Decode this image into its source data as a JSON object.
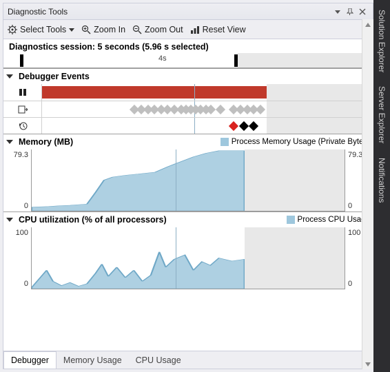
{
  "window": {
    "title": "Diagnostic Tools"
  },
  "toolbar": {
    "select_tools": "Select Tools",
    "zoom_in": "Zoom In",
    "zoom_out": "Zoom Out",
    "reset_view": "Reset View"
  },
  "session": {
    "label": "Diagnostics session: 5 seconds (5.96 s selected)",
    "ruler_label": "4s"
  },
  "sections": {
    "debugger": {
      "title": "Debugger Events"
    },
    "memory": {
      "title": "Memory (MB)",
      "legend": "Process Memory Usage (Private Bytes)",
      "ymax": "79.3",
      "ymin": "0"
    },
    "cpu": {
      "title": "CPU utilization (% of all processors)",
      "legend": "Process CPU Usage",
      "ymax": "100",
      "ymin": "0"
    }
  },
  "tabs": {
    "debugger": "Debugger",
    "memory": "Memory Usage",
    "cpu": "CPU Usage"
  },
  "side_tabs": {
    "solution": "Solution Explorer",
    "server": "Server Explorer",
    "notifications": "Notifications"
  },
  "chart_data": [
    {
      "type": "area",
      "title": "Memory (MB)",
      "ylabel": "MB",
      "ylim": [
        0,
        79.3
      ],
      "xlim_s": [
        0,
        5.96
      ],
      "series": [
        {
          "name": "Process Memory Usage (Private Bytes)",
          "points_pct": [
            [
              0,
              6
            ],
            [
              8,
              7
            ],
            [
              12,
              8
            ],
            [
              18,
              9
            ],
            [
              22,
              10
            ],
            [
              26,
              11
            ],
            [
              30,
              30
            ],
            [
              34,
              50
            ],
            [
              38,
              55
            ],
            [
              44,
              58
            ],
            [
              50,
              60
            ],
            [
              58,
              63
            ],
            [
              64,
              72
            ],
            [
              70,
              80
            ],
            [
              76,
              88
            ],
            [
              82,
              94
            ],
            [
              88,
              98
            ],
            [
              100,
              98
            ]
          ]
        }
      ]
    },
    {
      "type": "area",
      "title": "CPU utilization (% of all processors)",
      "ylabel": "%",
      "ylim": [
        0,
        100
      ],
      "xlim_s": [
        0,
        5.96
      ],
      "series": [
        {
          "name": "Process CPU Usage",
          "points_pct": [
            [
              0,
              2
            ],
            [
              4,
              18
            ],
            [
              7,
              30
            ],
            [
              10,
              12
            ],
            [
              14,
              5
            ],
            [
              18,
              10
            ],
            [
              22,
              4
            ],
            [
              26,
              8
            ],
            [
              30,
              25
            ],
            [
              33,
              40
            ],
            [
              36,
              20
            ],
            [
              40,
              35
            ],
            [
              44,
              18
            ],
            [
              48,
              30
            ],
            [
              52,
              12
            ],
            [
              56,
              22
            ],
            [
              60,
              60
            ],
            [
              63,
              35
            ],
            [
              67,
              48
            ],
            [
              72,
              55
            ],
            [
              76,
              30
            ],
            [
              80,
              44
            ],
            [
              84,
              38
            ],
            [
              88,
              50
            ],
            [
              94,
              45
            ],
            [
              100,
              48
            ]
          ]
        }
      ]
    }
  ]
}
